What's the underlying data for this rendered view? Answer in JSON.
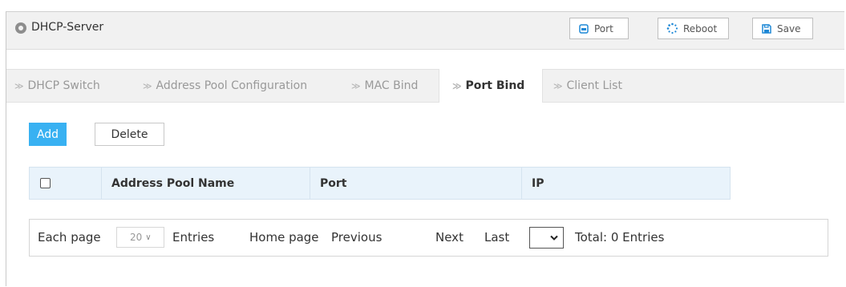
{
  "header": {
    "title": "DHCP-Server",
    "buttons": {
      "port": "Port",
      "reboot": "Reboot",
      "save": "Save"
    }
  },
  "tabs": [
    {
      "label": "DHCP Switch",
      "active": false
    },
    {
      "label": "Address Pool Configuration",
      "active": false
    },
    {
      "label": "MAC Bind",
      "active": false
    },
    {
      "label": "Port Bind",
      "active": true
    },
    {
      "label": "Client List",
      "active": false
    }
  ],
  "actions": {
    "add": "Add",
    "delete": "Delete"
  },
  "table": {
    "columns": [
      "Address Pool Name",
      "Port",
      "IP"
    ],
    "rows": []
  },
  "pagination": {
    "each_page": "Each page",
    "page_size": "20",
    "entries": "Entries",
    "home": "Home page",
    "previous": "Previous",
    "next": "Next",
    "last": "Last",
    "total": "Total: 0 Entries"
  },
  "colors": {
    "accent": "#38b1f2",
    "header_bg": "#f1f1f1",
    "table_header_bg": "#e9f3fb"
  },
  "icons": {
    "app": "circle-icon",
    "port": "port-icon",
    "reboot": "reboot-icon",
    "save": "save-icon"
  }
}
